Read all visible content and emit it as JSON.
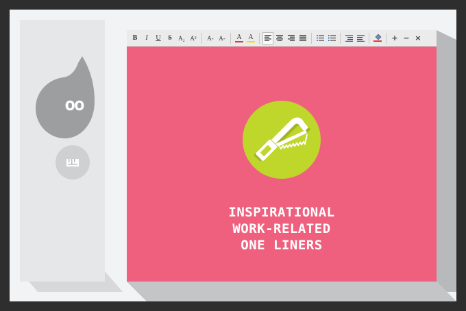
{
  "sidebar": {
    "quote_text": "oo",
    "quote_icon": "speech-quote-icon",
    "small_icon": "ruler-icon"
  },
  "toolbar": {
    "buttons": [
      {
        "label": "B",
        "icon": "bold-icon"
      },
      {
        "label": "I",
        "icon": "italic-icon"
      },
      {
        "label": "U",
        "icon": "underline-icon"
      },
      {
        "label": "S",
        "icon": "strikethrough-icon"
      },
      {
        "label": "A₂",
        "icon": "subscript-icon"
      },
      {
        "label": "A²",
        "icon": "superscript-icon"
      },
      {
        "label": "A-",
        "icon": "decrease-font-icon"
      },
      {
        "label": "A-",
        "icon": "increase-font-icon"
      },
      {
        "label": "A",
        "icon": "font-color-icon"
      },
      {
        "label": "A",
        "icon": "highlight-icon"
      }
    ],
    "window_controls": {
      "add": "+",
      "minimize": "−",
      "close": "×"
    },
    "font_color_swatch": "#e03a3a",
    "highlight_swatch": "#e8e21a"
  },
  "canvas": {
    "background": "#ee607e",
    "circle_color": "#bfd62b",
    "icon": "hacksaw-icon",
    "headline_lines": [
      "INSPIRATIONAL",
      "WORK-RELATED",
      "ONE LINERS"
    ]
  }
}
